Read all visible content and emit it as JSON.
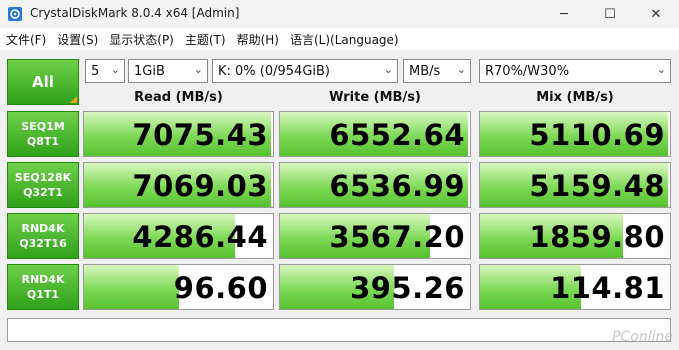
{
  "window": {
    "title": "CrystalDiskMark 8.0.4 x64 [Admin]",
    "minimize": "─",
    "maximize": "☐",
    "close": "✕"
  },
  "menu": [
    "文件(F)",
    "设置(S)",
    "显示状态(P)",
    "主题(T)",
    "帮助(H)",
    "语言(L)(Language)"
  ],
  "controls": {
    "all_label": "All",
    "count": "5",
    "size": "1GiB",
    "drive": "K: 0% (0/954GiB)",
    "unit": "MB/s",
    "mix": "R70%/W30%"
  },
  "columns": {
    "read": "Read (MB/s)",
    "write": "Write (MB/s)",
    "mix": "Mix (MB/s)"
  },
  "rows": [
    {
      "line1": "SEQ1M",
      "line2": "Q8T1",
      "read": "7075.43",
      "write": "6552.64",
      "mix": "5110.69"
    },
    {
      "line1": "SEQ128K",
      "line2": "Q32T1",
      "read": "7069.03",
      "write": "6536.99",
      "mix": "5159.48"
    },
    {
      "line1": "RND4K",
      "line2": "Q32T16",
      "read": "4286.44",
      "write": "3567.20",
      "mix": "1859.80"
    },
    {
      "line1": "RND4K",
      "line2": "Q1T1",
      "read": "96.60",
      "write": "395.26",
      "mix": "114.81"
    }
  ],
  "bar_levels": [
    {
      "read": 0.99,
      "write": 0.99,
      "mix": 0.99
    },
    {
      "read": 0.99,
      "write": 0.99,
      "mix": 0.99
    },
    {
      "read": 0.8,
      "write": 0.79,
      "mix": 0.75
    },
    {
      "read": 0.5,
      "write": 0.6,
      "mix": 0.53
    }
  ],
  "watermark": "PConline",
  "colors": {
    "label_green": "#2fa11a",
    "bar_green": "#7ed957",
    "accent_orange": "#f2a020"
  }
}
